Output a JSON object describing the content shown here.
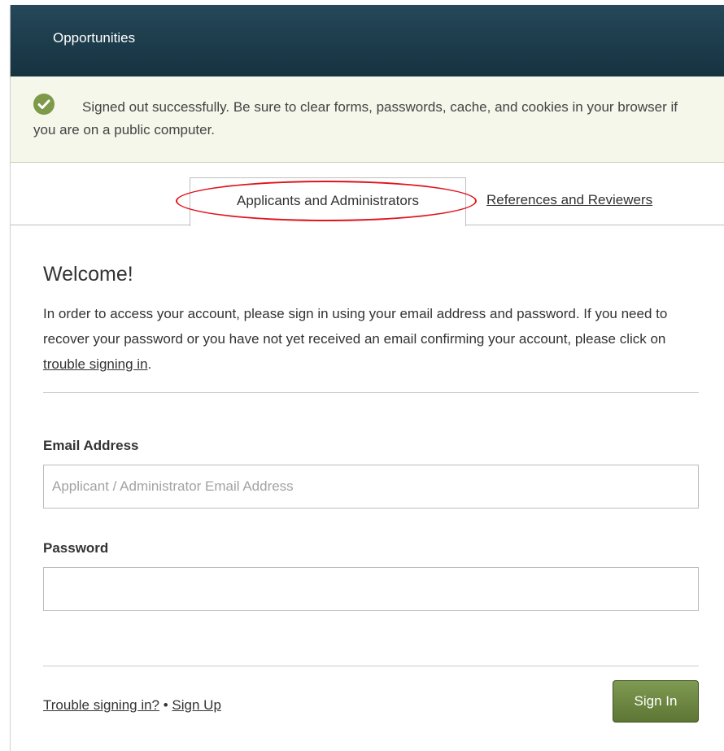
{
  "header": {
    "title": "Opportunities"
  },
  "alert": {
    "icon": "check-circle-icon",
    "message": "Signed out successfully. Be sure to clear forms, passwords, cache, and cookies in your browser if you are on a public computer.",
    "icon_color": "#7d9a4a"
  },
  "tabs": [
    {
      "label": "Applicants and Administrators",
      "active": true
    },
    {
      "label": "References and Reviewers",
      "active": false
    }
  ],
  "main": {
    "heading": "Welcome!",
    "intro_before": "In order to access your account, please sign in using your email address and password. If you need to recover your password or you have not yet received an email confirming your account, please click on ",
    "intro_link": "trouble signing in",
    "intro_after": "."
  },
  "form": {
    "email_label": "Email Address",
    "email_placeholder": "Applicant / Administrator Email Address",
    "email_value": "",
    "password_label": "Password",
    "password_value": ""
  },
  "footer": {
    "trouble_link": "Trouble signing in?",
    "separator": " • ",
    "signup_link": "Sign Up",
    "signin_button": "Sign In"
  },
  "colors": {
    "header": "#1c3b4a",
    "alert_background": "#f4f7ea",
    "button": "#6b8540",
    "highlight": "#e0141e"
  }
}
